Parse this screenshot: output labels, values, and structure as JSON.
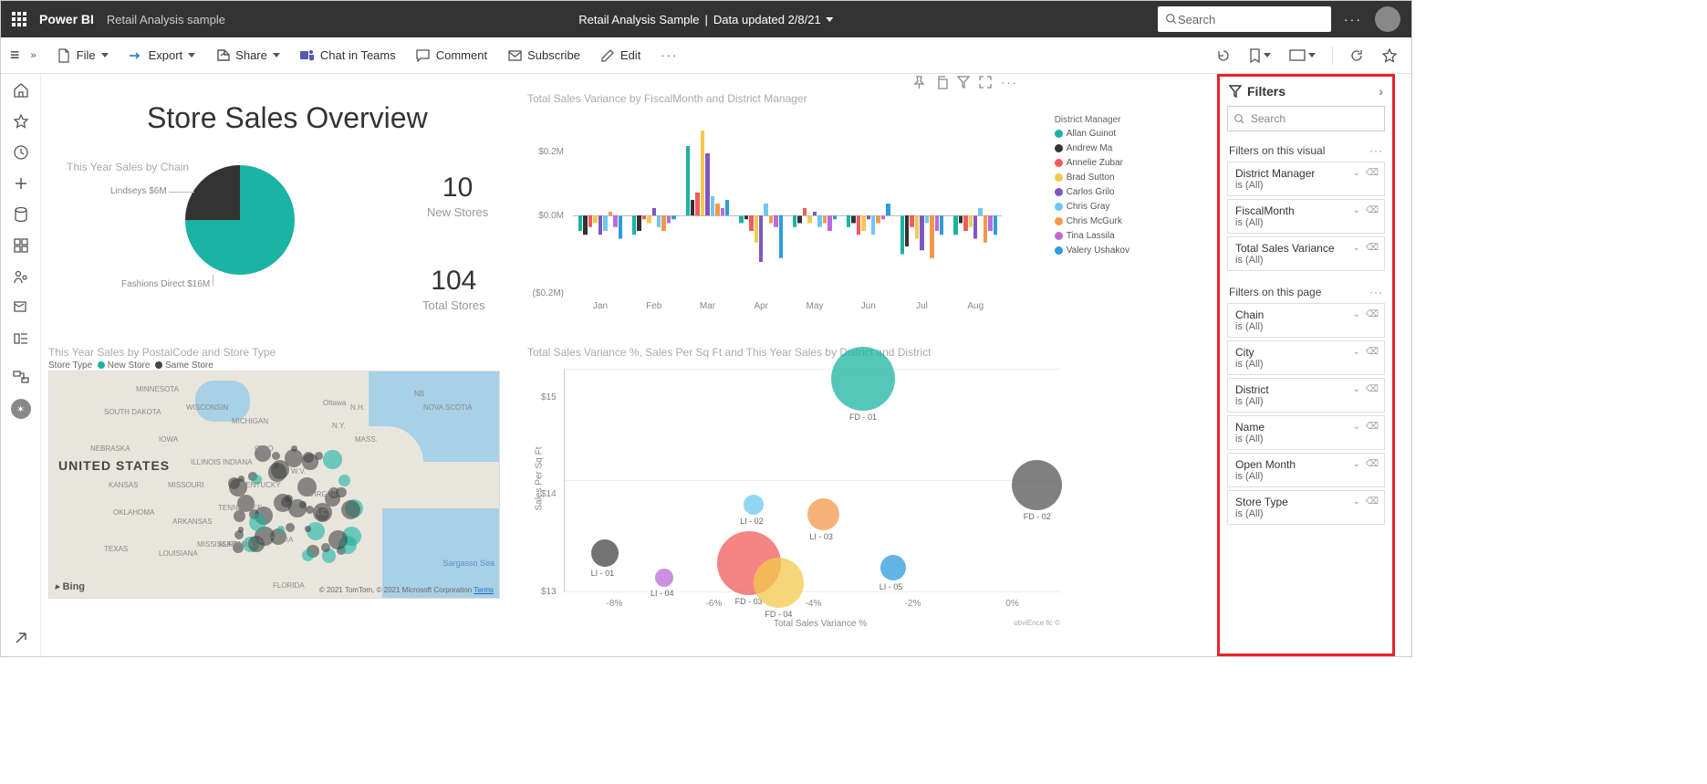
{
  "header": {
    "brand": "Power BI",
    "sample_name": "Retail Analysis sample",
    "center_title": "Retail Analysis Sample",
    "updated": "Data updated 2/8/21",
    "search_placeholder": "Search"
  },
  "ribbon": {
    "file": "File",
    "export": "Export",
    "share": "Share",
    "chat": "Chat in Teams",
    "comment": "Comment",
    "subscribe": "Subscribe",
    "edit": "Edit"
  },
  "dashboard": {
    "title": "Store Sales Overview",
    "pie_title": "This Year Sales by Chain",
    "pie_labels": {
      "lindseys": "Lindseys $6M",
      "fashions": "Fashions Direct $16M"
    },
    "kpi1_value": "10",
    "kpi1_label": "New Stores",
    "kpi2_value": "104",
    "kpi2_label": "Total Stores",
    "bar_title": "Total Sales Variance by FiscalMonth and District Manager",
    "map_title": "This Year Sales by PostalCode and Store Type",
    "map_legend_label": "Store Type",
    "map_legend_new": "New Store",
    "map_legend_same": "Same Store",
    "map_bing": "Bing",
    "map_credit_tomtom": "© 2021 TomTom,",
    "map_credit_ms": "© 2021 Microsoft Corporation",
    "map_credit_terms": "Terms",
    "map_sargasso": "Sargasso Sea",
    "us_label": "UNITED STATES",
    "scatter_title": "Total Sales Variance %, Sales Per Sq Ft and This Year Sales by District and District",
    "scatter_xlabel": "Total Sales Variance %",
    "scatter_ylabel": "Sales Per Sq Ft",
    "footer_credit": "obviEnce llc ©"
  },
  "chart_data": {
    "pie": {
      "type": "pie",
      "title": "This Year Sales by Chain",
      "series": [
        {
          "name": "Lindseys",
          "value": 6,
          "unit": "$M",
          "color": "#333333"
        },
        {
          "name": "Fashions Direct",
          "value": 16,
          "unit": "$M",
          "color": "#1BB3A3"
        }
      ]
    },
    "bar": {
      "type": "grouped-bar",
      "title": "Total Sales Variance by FiscalMonth and District Manager",
      "ylabel": "",
      "yticks": [
        "$0.2M",
        "$0.0M",
        "($0.2M)"
      ],
      "ylim": [
        -0.2,
        0.2
      ],
      "categories": [
        "Jan",
        "Feb",
        "Mar",
        "Apr",
        "May",
        "Jun",
        "Jul",
        "Aug"
      ],
      "legend_title": "District Manager",
      "series": [
        {
          "name": "Allan Guinot",
          "color": "#1BB3A3",
          "values": [
            -0.04,
            -0.05,
            0.18,
            -0.02,
            -0.03,
            -0.03,
            -0.1,
            -0.05
          ]
        },
        {
          "name": "Andrew Ma",
          "color": "#333333",
          "values": [
            -0.05,
            -0.04,
            0.04,
            -0.01,
            -0.02,
            -0.02,
            -0.08,
            -0.02
          ]
        },
        {
          "name": "Annelie Zubar",
          "color": "#F15B5B",
          "values": [
            -0.03,
            -0.01,
            0.06,
            -0.04,
            0.02,
            -0.05,
            -0.03,
            -0.04
          ]
        },
        {
          "name": "Brad Sutton",
          "color": "#F2C94C",
          "values": [
            -0.02,
            -0.02,
            0.22,
            -0.07,
            -0.02,
            -0.04,
            -0.06,
            -0.03
          ]
        },
        {
          "name": "Carlos Grilo",
          "color": "#7E57C2",
          "values": [
            -0.05,
            0.02,
            0.16,
            -0.12,
            0.01,
            -0.01,
            -0.09,
            -0.06
          ]
        },
        {
          "name": "Chris Gray",
          "color": "#6EC8F1",
          "values": [
            -0.04,
            -0.03,
            0.05,
            0.03,
            -0.03,
            -0.05,
            -0.02,
            0.02
          ]
        },
        {
          "name": "Chris McGurk",
          "color": "#F2994A",
          "values": [
            0.01,
            -0.04,
            0.03,
            -0.02,
            -0.02,
            -0.02,
            -0.11,
            -0.07
          ]
        },
        {
          "name": "Tina Lassila",
          "color": "#BB6BD9",
          "values": [
            -0.03,
            -0.02,
            0.02,
            -0.03,
            -0.04,
            -0.01,
            -0.04,
            -0.04
          ]
        },
        {
          "name": "Valery Ushakov",
          "color": "#2D9CDB",
          "values": [
            -0.06,
            -0.01,
            0.04,
            -0.11,
            -0.01,
            0.03,
            -0.05,
            -0.05
          ]
        }
      ]
    },
    "scatter": {
      "type": "bubble",
      "title": "Total Sales Variance %, Sales Per Sq Ft and This Year Sales by District and District",
      "xlabel": "Total Sales Variance %",
      "ylabel": "Sales Per Sq Ft",
      "xticks": [
        "-8%",
        "-6%",
        "-4%",
        "-2%",
        "0%"
      ],
      "yticks": [
        "$13",
        "$14",
        "$15"
      ],
      "points": [
        {
          "label": "FD - 01",
          "x": -3.0,
          "y": 15.2,
          "size": 70,
          "color": "#1BB3A3"
        },
        {
          "label": "FD - 02",
          "x": 0.5,
          "y": 14.1,
          "size": 55,
          "color": "#555555"
        },
        {
          "label": "FD - 03",
          "x": -5.3,
          "y": 13.3,
          "size": 70,
          "color": "#F15B5B"
        },
        {
          "label": "FD - 04",
          "x": -4.7,
          "y": 13.1,
          "size": 55,
          "color": "#F2C94C"
        },
        {
          "label": "LI - 01",
          "x": -8.2,
          "y": 13.4,
          "size": 30,
          "color": "#444444"
        },
        {
          "label": "LI - 02",
          "x": -5.2,
          "y": 13.9,
          "size": 22,
          "color": "#6EC8F1"
        },
        {
          "label": "LI - 03",
          "x": -3.8,
          "y": 13.8,
          "size": 35,
          "color": "#F2994A"
        },
        {
          "label": "LI - 04",
          "x": -7.0,
          "y": 13.15,
          "size": 20,
          "color": "#BB6BD9"
        },
        {
          "label": "LI - 05",
          "x": -2.4,
          "y": 13.25,
          "size": 28,
          "color": "#2D9CDB"
        }
      ]
    }
  },
  "filters": {
    "title": "Filters",
    "search_placeholder": "Search",
    "visual_section": "Filters on this visual",
    "page_section": "Filters on this page",
    "visual": [
      {
        "name": "District Manager",
        "value": "is (All)"
      },
      {
        "name": "FiscalMonth",
        "value": "is (All)"
      },
      {
        "name": "Total Sales Variance",
        "value": "is (All)"
      }
    ],
    "page": [
      {
        "name": "Chain",
        "value": "is (All)"
      },
      {
        "name": "City",
        "value": "is (All)"
      },
      {
        "name": "District",
        "value": "is (All)"
      },
      {
        "name": "Name",
        "value": "is (All)"
      },
      {
        "name": "Open Month",
        "value": "is (All)"
      },
      {
        "name": "Store Type",
        "value": "is (All)"
      }
    ]
  },
  "map_states": [
    "MINNESOTA",
    "WISCONSIN",
    "MICHIGAN",
    "SOUTH DAKOTA",
    "IOWA",
    "NEBRASKA",
    "ILLINOIS",
    "INDIANA",
    "OHIO",
    "KANSAS",
    "MISSOURI",
    "OKLAHOMA",
    "ARKANSAS",
    "TEXAS",
    "LOUISIANA",
    "MISSISSIPPI",
    "ALABAMA",
    "GEORGIA",
    "FLORIDA",
    "TENNESSEE",
    "KENTUCKY",
    "W.V.",
    "VIRGINIA",
    "N.C.",
    "N.Y.",
    "MASS.",
    "N.H.",
    "NB",
    "NOVA SCOTIA",
    "Ottawa"
  ]
}
